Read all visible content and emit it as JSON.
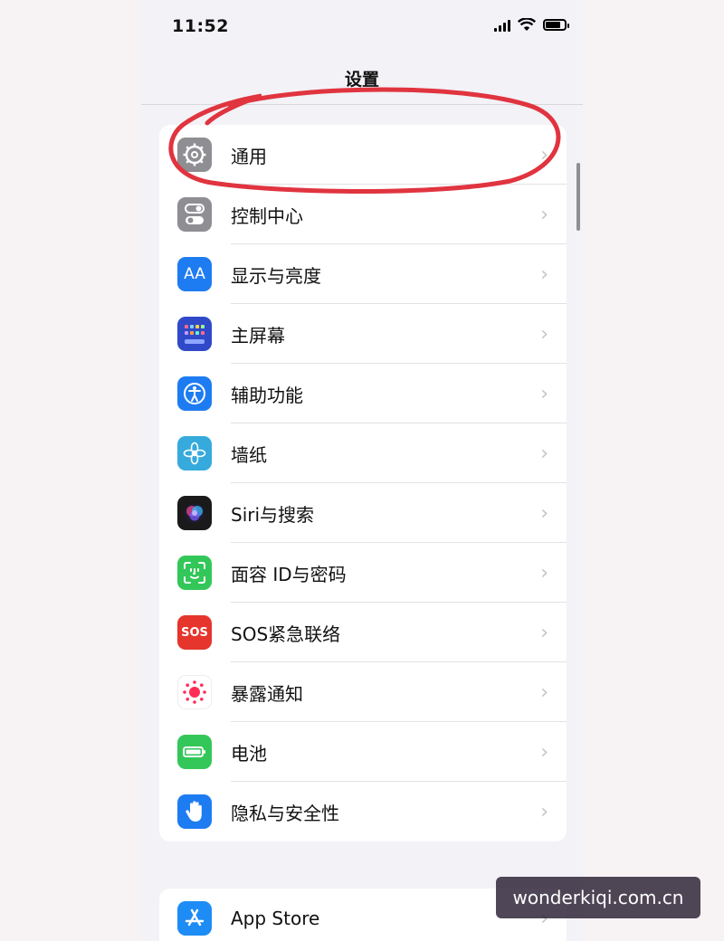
{
  "status_bar": {
    "time": "11:52"
  },
  "nav": {
    "title": "设置"
  },
  "group1": [
    {
      "label": "通用",
      "icon": "gear-icon",
      "color": "#8e8e93"
    },
    {
      "label": "控制中心",
      "icon": "control-center-icon",
      "color": "#8e8e93"
    },
    {
      "label": "显示与亮度",
      "icon": "display-brightness-icon",
      "color": "#1e7cf2",
      "glyph": "AA"
    },
    {
      "label": "主屏幕",
      "icon": "home-screen-icon",
      "color": "#2f49c9"
    },
    {
      "label": "辅助功能",
      "icon": "accessibility-icon",
      "color": "#1e7cf2"
    },
    {
      "label": "墙纸",
      "icon": "wallpaper-icon",
      "color": "#36aadc"
    },
    {
      "label": "Siri与搜索",
      "icon": "siri-icon",
      "color": "#1a1a1a"
    },
    {
      "label": "面容 ID与密码",
      "icon": "face-id-icon",
      "color": "#33c759"
    },
    {
      "label": "SOS紧急联络",
      "icon": "sos-icon",
      "color": "#e5352d",
      "glyph": "SOS"
    },
    {
      "label": "暴露通知",
      "icon": "exposure-notification-icon",
      "color": "#ffffff"
    },
    {
      "label": "电池",
      "icon": "battery-icon",
      "color": "#33c759"
    },
    {
      "label": "隐私与安全性",
      "icon": "privacy-hand-icon",
      "color": "#1e7cf2"
    }
  ],
  "group2": [
    {
      "label": "App Store",
      "icon": "app-store-icon",
      "color": "#1e8cf5"
    }
  ],
  "watermark": "wonderkiqi.com.cn",
  "annotation_color": "#e0343f"
}
